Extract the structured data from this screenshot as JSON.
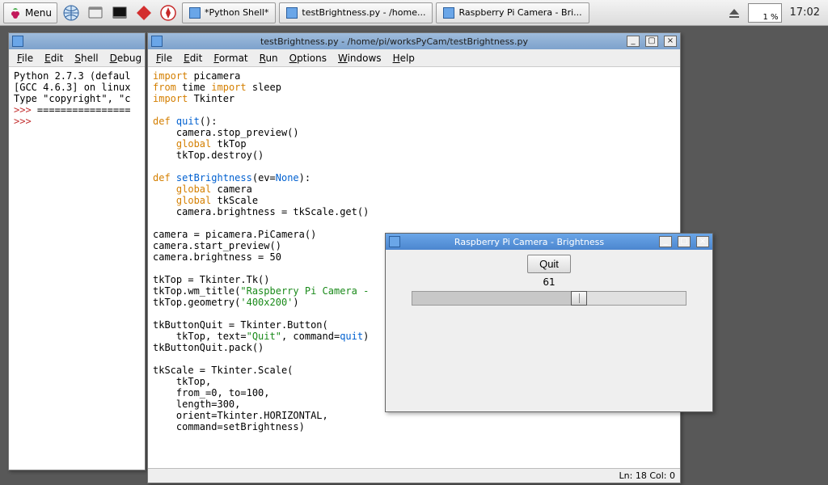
{
  "taskbar": {
    "menu_label": "Menu",
    "tasks": [
      {
        "label": "*Python Shell*"
      },
      {
        "label": "testBrightness.py - /home..."
      },
      {
        "label": "Raspberry Pi Camera - Bri..."
      }
    ],
    "cpu": "1 %",
    "clock": "17:02"
  },
  "shell_window": {
    "menus": [
      "File",
      "Edit",
      "Shell",
      "Debug"
    ],
    "lines": [
      {
        "t": "Python 2.7.3 (defaul"
      },
      {
        "t": "[GCC 4.6.3] on linux"
      },
      {
        "t": "Type \"copyright\", \"c"
      },
      {
        "prompt": ">>> ",
        "t": "================"
      },
      {
        "prompt": ">>> ",
        "t": ""
      }
    ]
  },
  "editor_window": {
    "title": "testBrightness.py - /home/pi/worksPyCam/testBrightness.py",
    "menus": [
      "File",
      "Edit",
      "Format",
      "Run",
      "Options",
      "Windows",
      "Help"
    ],
    "status": "Ln: 18 Col: 0",
    "code_tokens": [
      [
        [
          "kw",
          "import"
        ],
        [
          "",
          " picamera"
        ]
      ],
      [
        [
          "kw",
          "from"
        ],
        [
          "",
          " time "
        ],
        [
          "kw",
          "import"
        ],
        [
          "",
          " sleep"
        ]
      ],
      [
        [
          "kw",
          "import"
        ],
        [
          "",
          " Tkinter"
        ]
      ],
      [],
      [
        [
          "kw",
          "def"
        ],
        [
          "",
          " "
        ],
        [
          "def",
          "quit"
        ],
        [
          "",
          "():"
        ]
      ],
      [
        [
          "",
          "    camera.stop_preview()"
        ]
      ],
      [
        [
          "",
          "    "
        ],
        [
          "glb",
          "global"
        ],
        [
          "",
          " tkTop"
        ]
      ],
      [
        [
          "",
          "    tkTop.destroy()"
        ]
      ],
      [],
      [
        [
          "kw",
          "def"
        ],
        [
          "",
          " "
        ],
        [
          "def",
          "setBrightness"
        ],
        [
          "",
          "(ev="
        ],
        [
          "def",
          "None"
        ],
        [
          "",
          "):"
        ]
      ],
      [
        [
          "",
          "    "
        ],
        [
          "glb",
          "global"
        ],
        [
          "",
          " camera"
        ]
      ],
      [
        [
          "",
          "    "
        ],
        [
          "glb",
          "global"
        ],
        [
          "",
          " tkScale"
        ]
      ],
      [
        [
          "",
          "    camera.brightness = tkScale.get()"
        ]
      ],
      [],
      [
        [
          "",
          "camera = picamera.PiCamera()"
        ]
      ],
      [
        [
          "",
          "camera.start_preview()"
        ]
      ],
      [
        [
          "",
          "camera.brightness = 50"
        ]
      ],
      [],
      [
        [
          "",
          "tkTop = Tkinter.Tk()"
        ]
      ],
      [
        [
          "",
          "tkTop.wm_title("
        ],
        [
          "str",
          "\"Raspberry Pi Camera - "
        ],
        [
          "",
          ""
        ]
      ],
      [
        [
          "",
          "tkTop.geometry("
        ],
        [
          "str",
          "'400x200'"
        ],
        [
          "",
          ")"
        ]
      ],
      [],
      [
        [
          "",
          "tkButtonQuit = Tkinter.Button("
        ]
      ],
      [
        [
          "",
          "    tkTop, text="
        ],
        [
          "str",
          "\"Quit\""
        ],
        [
          "",
          ", command="
        ],
        [
          "def",
          "quit"
        ],
        [
          "",
          ")"
        ]
      ],
      [
        [
          "",
          "tkButtonQuit.pack()"
        ]
      ],
      [],
      [
        [
          "",
          "tkScale = Tkinter.Scale("
        ]
      ],
      [
        [
          "",
          "    tkTop,"
        ]
      ],
      [
        [
          "",
          "    from_=0, to=100,"
        ]
      ],
      [
        [
          "",
          "    length=300,"
        ]
      ],
      [
        [
          "",
          "    orient=Tkinter.HORIZONTAL,"
        ]
      ],
      [
        [
          "",
          "    command=setBrightness)"
        ]
      ]
    ]
  },
  "tk_dialog": {
    "title": "Raspberry Pi Camera - Brightness",
    "quit_label": "Quit",
    "scale_value": "61",
    "scale_min": 0,
    "scale_max": 100
  }
}
